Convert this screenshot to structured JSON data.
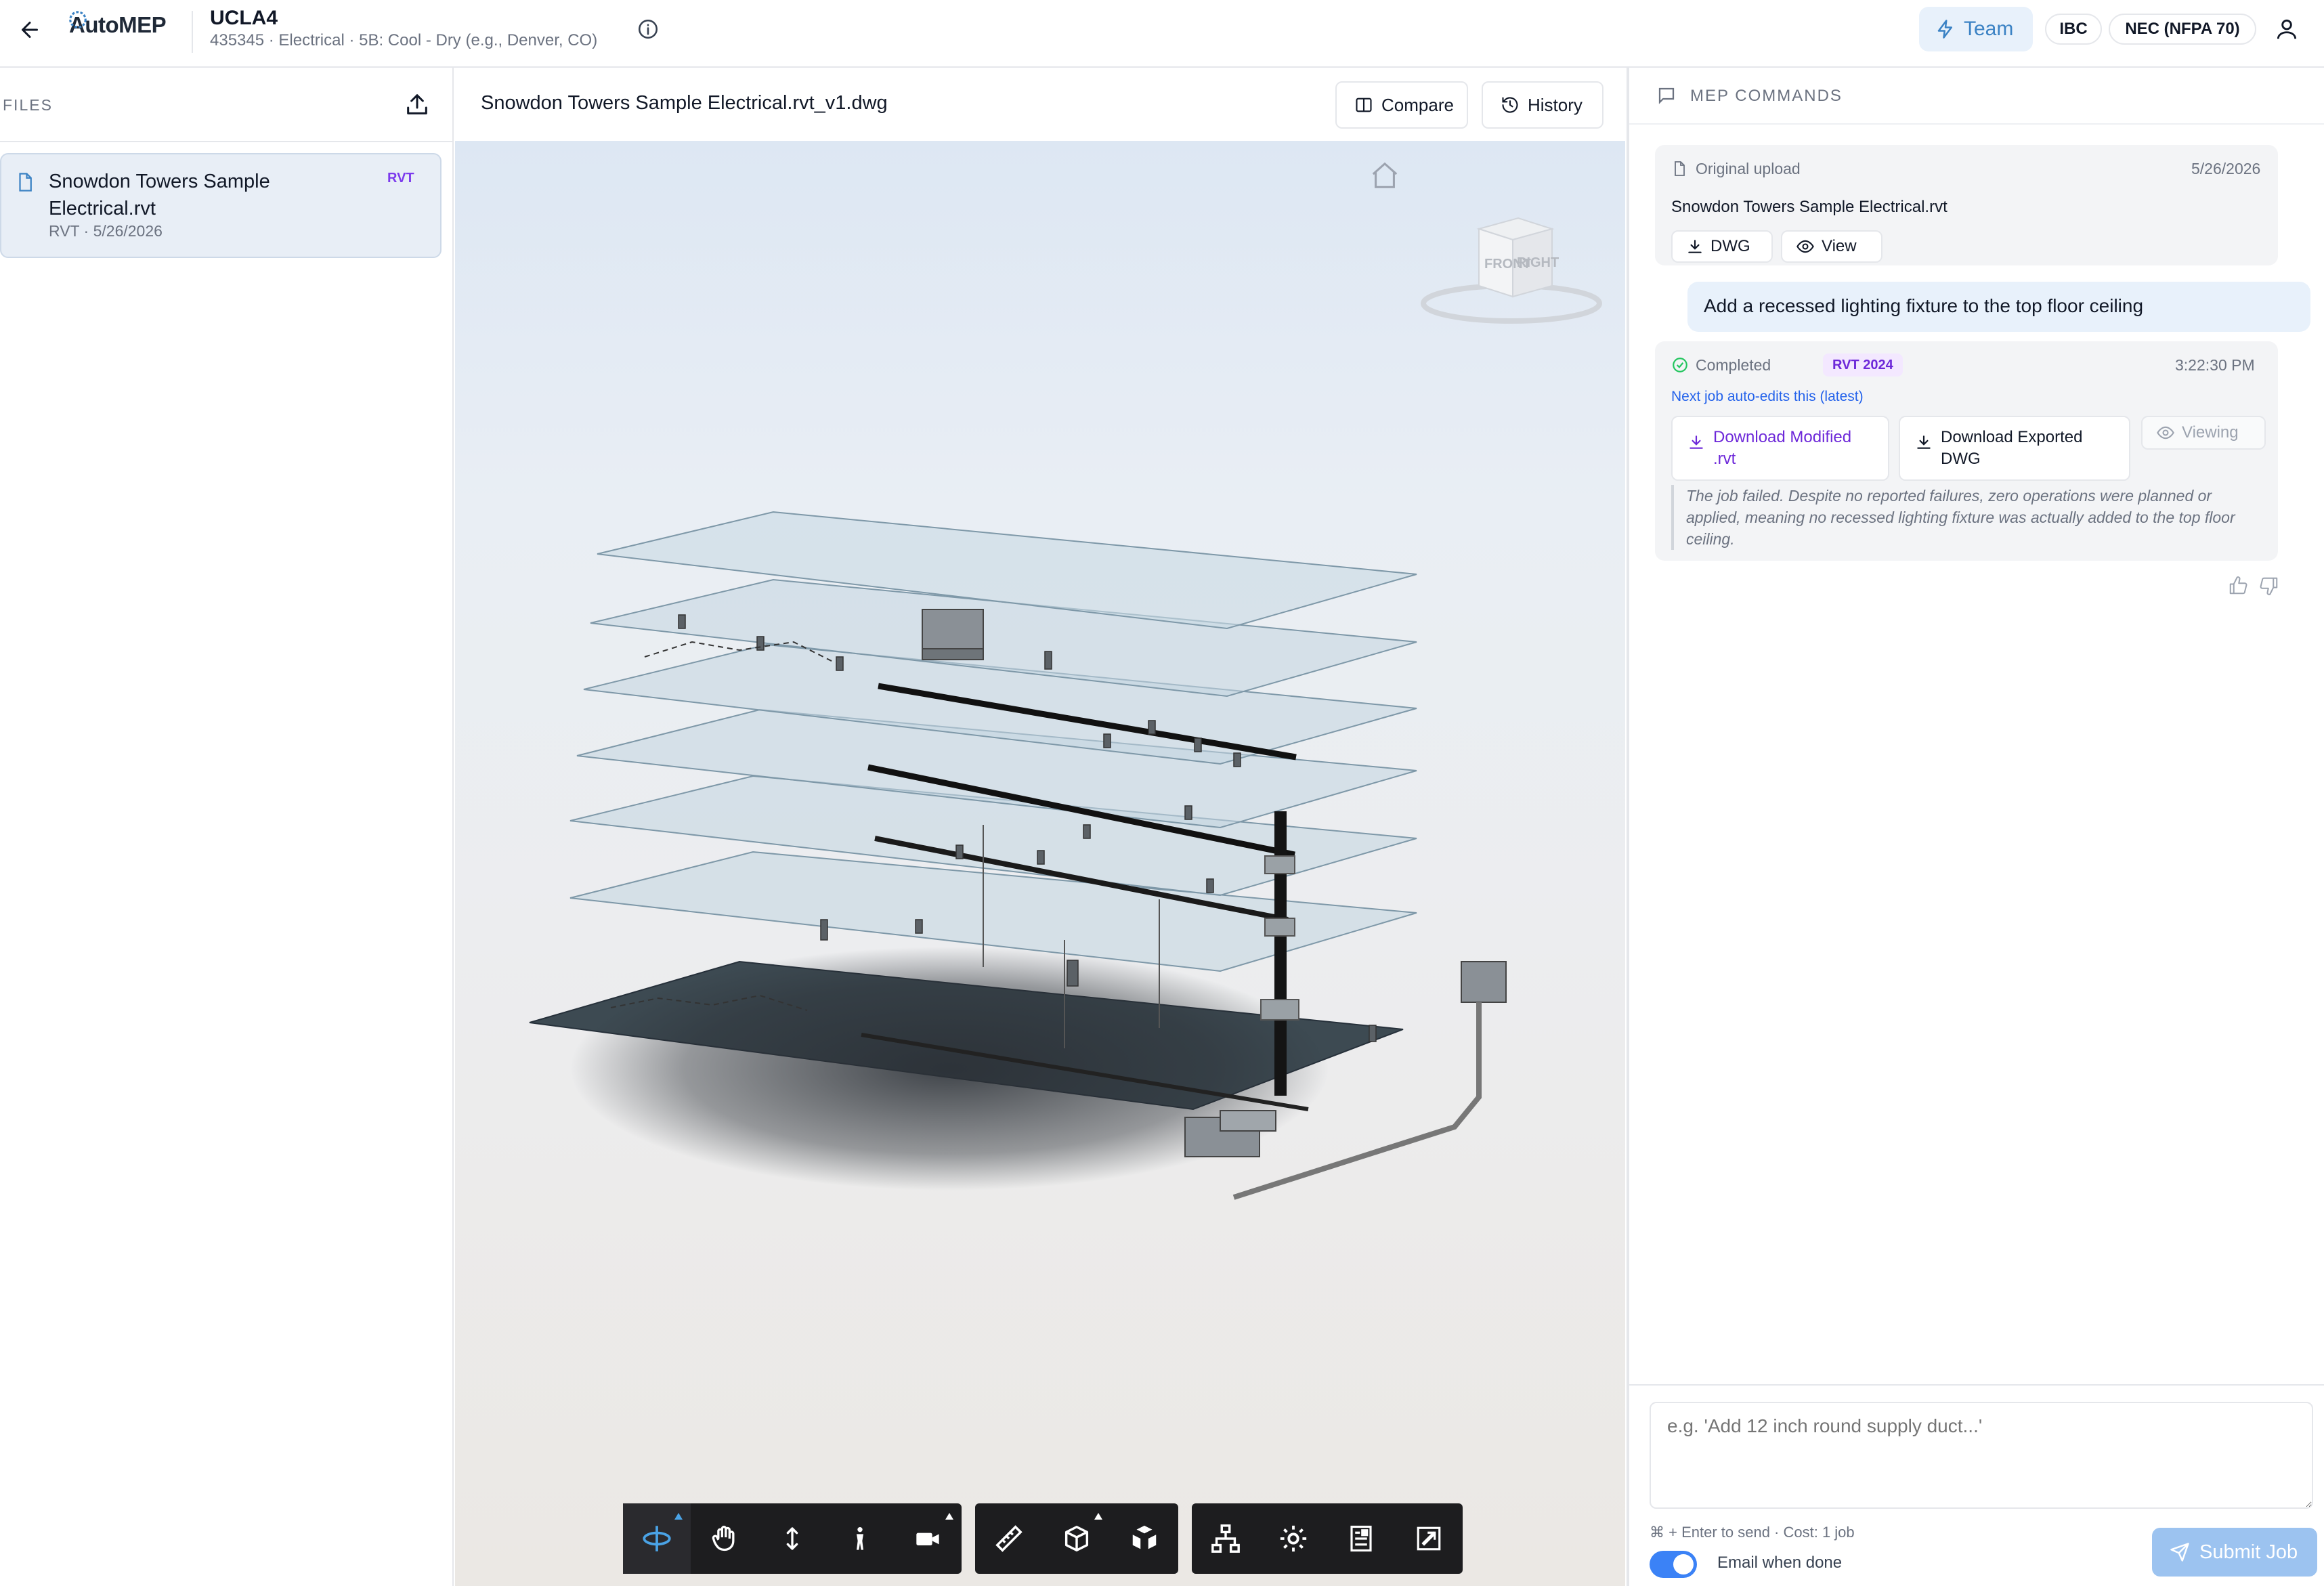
{
  "header": {
    "logo_text": "AutoMEP",
    "project_title": "UCLA4",
    "project_subtitle": "435345 · Electrical · 5B: Cool - Dry (e.g., Denver, CO)",
    "team_label": "Team",
    "code_pills": [
      "IBC",
      "NEC (NFPA 70)"
    ]
  },
  "files_panel": {
    "heading": "FILES",
    "file": {
      "name": "Snowdon Towers Sample Electrical.rvt",
      "meta": "RVT · 5/26/2026",
      "tag": "RVT"
    }
  },
  "viewer": {
    "title": "Snowdon Towers Sample Electrical.rvt_v1.dwg",
    "compare_label": "Compare",
    "history_label": "History",
    "viewcube": {
      "front": "FRONT",
      "right": "RIGHT"
    }
  },
  "mep_panel": {
    "heading": "MEP COMMANDS",
    "original": {
      "label": "Original upload",
      "date": "5/26/2026",
      "filename": "Snowdon Towers Sample Electrical.rvt",
      "dwg_label": "DWG",
      "view_label": "View"
    },
    "user_message": "Add a recessed lighting fixture to the top floor ceiling",
    "job": {
      "status": "Completed",
      "badge": "RVT 2024",
      "time": "3:22:30 PM",
      "next_link": "Next job auto-edits this (latest)",
      "download_rvt": "Download Modified .rvt",
      "download_dwg": "Download Exported DWG",
      "viewing_label": "Viewing",
      "result_text": "The job failed. Despite no reported failures, zero operations were planned or applied, meaning no recessed lighting fixture was actually added to the top floor ceiling."
    },
    "composer": {
      "placeholder": "e.g. 'Add 12 inch round supply duct...'",
      "hint": "⌘ + Enter to send · Cost: 1 job",
      "email_label": "Email when done",
      "email_enabled": true,
      "submit_label": "Submit Job"
    }
  },
  "colors": {
    "accent": "#3b82c4",
    "badge_purple": "#6d28d9",
    "link_blue": "#2563eb",
    "status_green": "#22c55e"
  }
}
